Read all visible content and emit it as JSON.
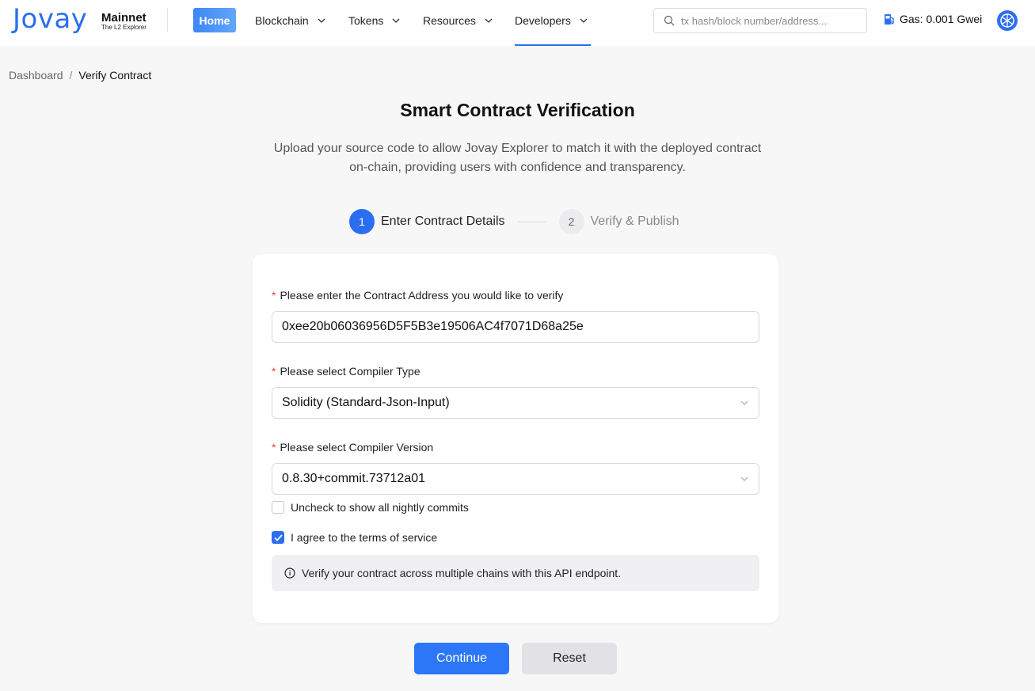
{
  "brand": {
    "logo": "Jovay",
    "network": "Mainnet",
    "tagline": "The L2 Explorer",
    "accent_color": "#2b6ef2"
  },
  "nav": {
    "home": "Home",
    "items": [
      {
        "label": "Blockchain"
      },
      {
        "label": "Tokens"
      },
      {
        "label": "Resources"
      },
      {
        "label": "Developers"
      }
    ],
    "active": "Developers"
  },
  "search": {
    "placeholder": "tx hash/block number/address...",
    "icon": "search-icon"
  },
  "gas": {
    "label": "Gas: 0.001 Gwei",
    "icon": "gas-pump-icon"
  },
  "breadcrumb": {
    "home": "Dashboard",
    "separator": "/",
    "current": "Verify Contract"
  },
  "page": {
    "title": "Smart Contract Verification",
    "subtitle_line1": "Upload your source code to allow Jovay Explorer to match it with the deployed contract",
    "subtitle_line2": "on-chain, providing users with confidence and transparency."
  },
  "steps": [
    {
      "number": "1",
      "label": "Enter Contract Details",
      "state": "active"
    },
    {
      "number": "2",
      "label": "Verify & Publish",
      "state": "inactive"
    }
  ],
  "form": {
    "required_mark": "*",
    "address_label": "Please enter the Contract Address you would like to verify",
    "address_value": "0xee20b06036956D5F5B3e19506AC4f7071D68a25e",
    "compiler_type_label": "Please select Compiler Type",
    "compiler_type_value": "Solidity (Standard-Json-Input)",
    "compiler_version_label": "Please select Compiler Version",
    "compiler_version_value": "0.8.30+commit.73712a01",
    "nightly_label": "Uncheck to show all nightly commits",
    "nightly_checked": false,
    "terms_label": "I agree to the terms of service",
    "terms_checked": true,
    "info_text": "Verify your contract across multiple chains with this API endpoint."
  },
  "actions": {
    "continue": "Continue",
    "reset": "Reset"
  }
}
